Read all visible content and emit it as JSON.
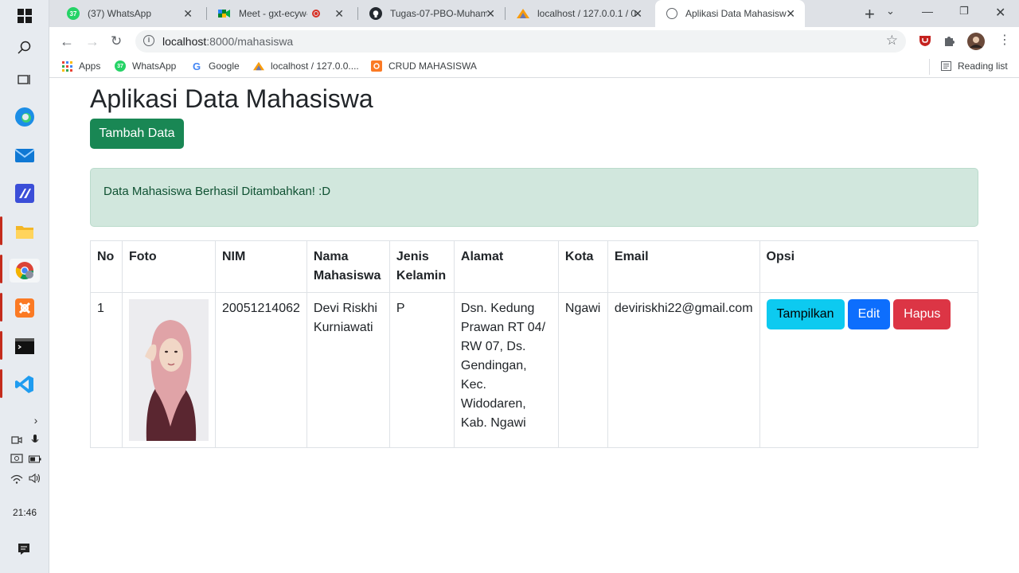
{
  "taskbar": {
    "clock": "21:46"
  },
  "browser": {
    "tabs": [
      {
        "title": "(37) WhatsApp",
        "badge": "37"
      },
      {
        "title": "Meet - gxt-ecyw-sp"
      },
      {
        "title": "Tugas-07-PBO-Muham"
      },
      {
        "title": "localhost / 127.0.0.1 / 0"
      },
      {
        "title": "Aplikasi Data Mahasisw"
      }
    ],
    "url_host": "localhost",
    "url_path": ":8000/mahasiswa",
    "bookmarks": [
      "Apps",
      "WhatsApp",
      "Google",
      "localhost / 127.0.0....",
      "CRUD MAHASISWA"
    ],
    "reading_list": "Reading list",
    "whatsapp_badge": "37"
  },
  "page": {
    "title": "Aplikasi Data Mahasiswa",
    "add_button": "Tambah Data",
    "alert": "Data Mahasiswa Berhasil Ditambahkan! :D",
    "table": {
      "headers": [
        "No",
        "Foto",
        "NIM",
        "Nama Mahasiswa",
        "Jenis Kelamin",
        "Alamat",
        "Kota",
        "Email",
        "Opsi"
      ],
      "rows": [
        {
          "no": "1",
          "nim": "20051214062",
          "nama": "Devi Riskhi Kurniawati",
          "jk": "P",
          "alamat": "Dsn. Kedung Prawan RT 04/ RW 07, Ds. Gendingan, Kec. Widodaren, Kab. Ngawi",
          "kota": "Ngawi",
          "email": "deviriskhi22@gmail.com",
          "btn_show": "Tampilkan",
          "btn_edit": "Edit",
          "btn_delete": "Hapus"
        }
      ]
    }
  },
  "colors": {
    "success": "#198754",
    "info": "#0dcaf0",
    "primary": "#0d6efd",
    "danger": "#dc3545",
    "alert_bg": "#d1e7dd"
  }
}
